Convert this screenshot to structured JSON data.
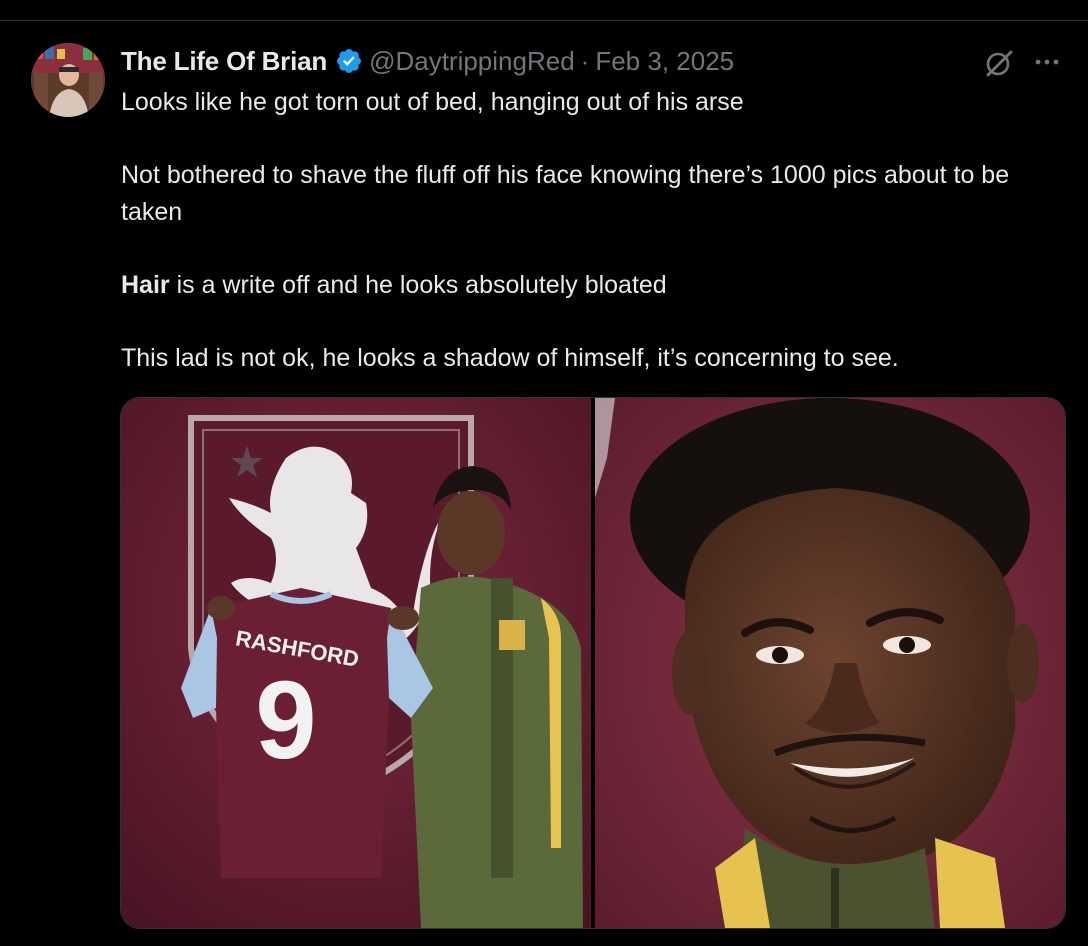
{
  "tweet": {
    "author_name": "The Life Of Brian",
    "handle": "@DaytrippingRed",
    "separator": "·",
    "date": "Feb 3, 2025",
    "paragraphs": {
      "p1": "Looks like he got torn out of bed, hanging out of his arse",
      "p2": "Not bothered to shave the fluff off his face knowing there’s 1000 pics about to be taken",
      "p3_bold": "Hair",
      "p3_rest": " is a write off and he looks absolutely bloated",
      "p4": "This lad is not ok, he looks a shadow of himself, it’s concerning to see."
    },
    "media": {
      "jersey_name": "RASHFORD",
      "jersey_number": "9"
    }
  },
  "icons": {
    "verified": "verified-badge-icon",
    "grok": "grok-icon",
    "more": "more-options-icon"
  },
  "colors": {
    "background": "#000000",
    "text_primary": "#e7e9ea",
    "text_secondary": "#71767b",
    "verified_blue": "#1d9bf0",
    "claret": "#6b1f33"
  }
}
